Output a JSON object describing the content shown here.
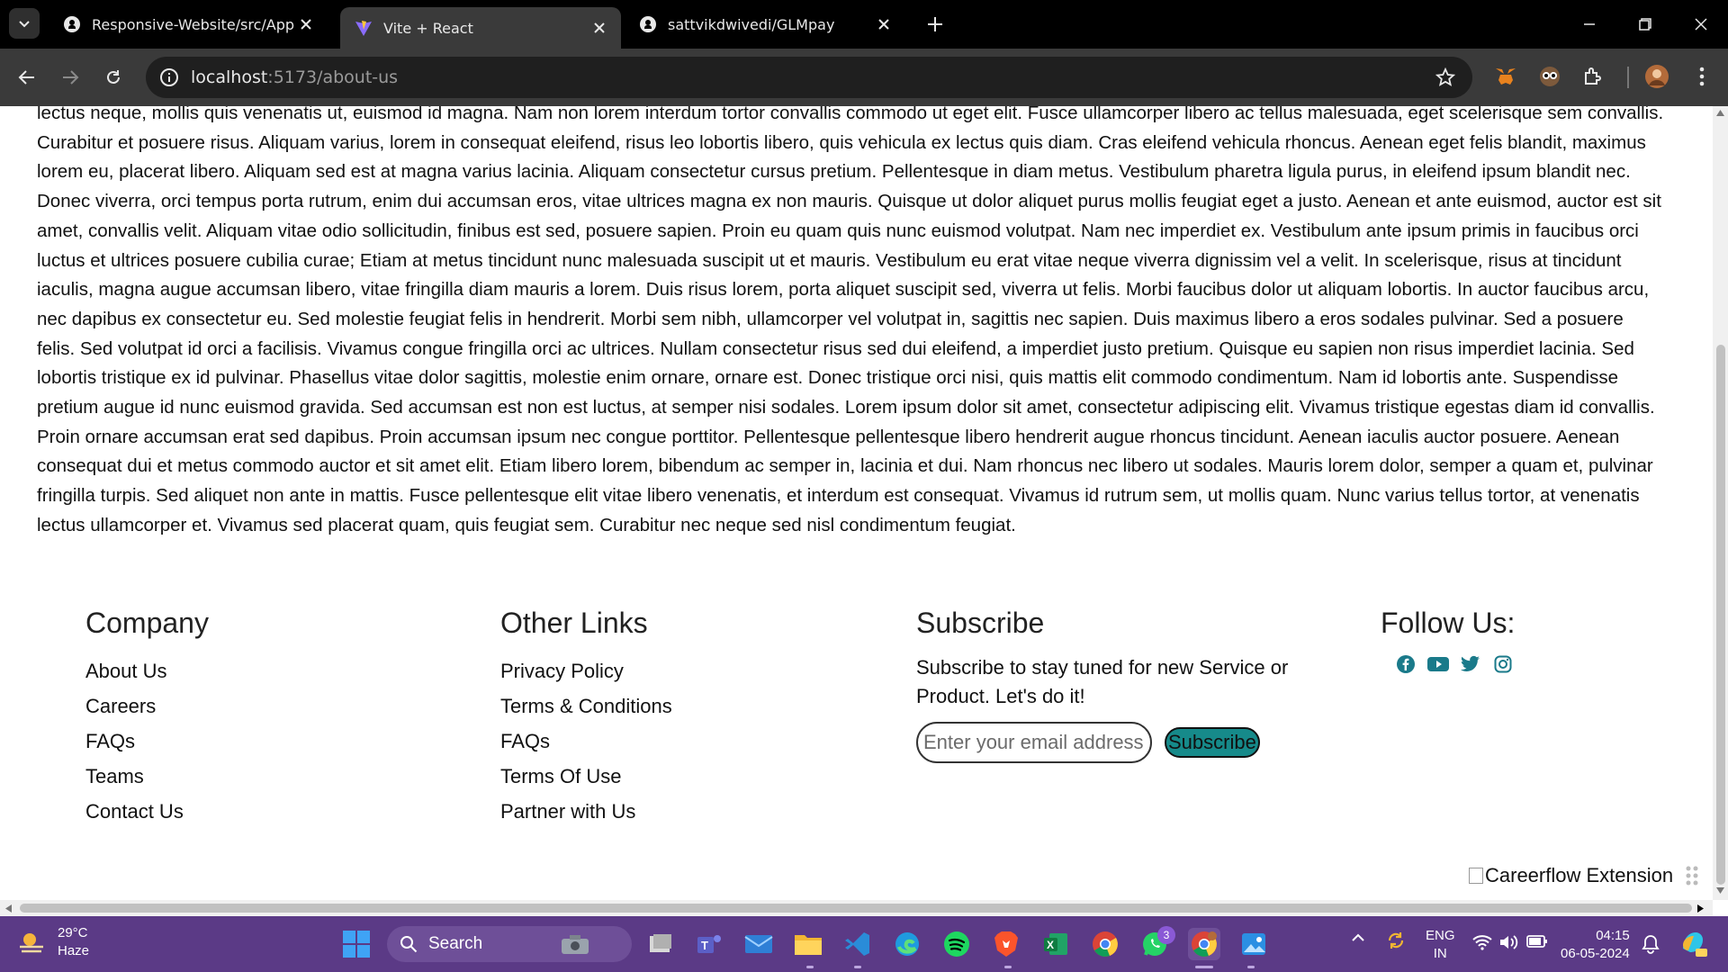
{
  "browser": {
    "tabs": [
      {
        "title": "Responsive-Website/src/App.jsx",
        "icon": "github-icon",
        "active": false
      },
      {
        "title": "Vite + React",
        "icon": "vite-icon",
        "active": true
      },
      {
        "title": "sattvikdwivedi/GLMpay",
        "icon": "github-icon",
        "active": false
      }
    ],
    "url_host": "localhost",
    "url_path": ":5173/about-us"
  },
  "article": {
    "text": "lectus neque, mollis quis venenatis ut, euismod id magna. Nam non lorem interdum tortor convallis commodo ut eget elit. Fusce ullamcorper libero ac tellus malesuada, eget scelerisque sem convallis. Curabitur et posuere risus. Aliquam varius, lorem in consequat eleifend, risus leo lobortis libero, quis vehicula ex lectus quis diam. Cras eleifend vehicula rhoncus. Aenean eget felis blandit, maximus lorem eu, placerat libero. Aliquam sed est at magna varius lacinia. Aliquam consectetur cursus pretium. Pellentesque in diam metus. Vestibulum pharetra ligula purus, in eleifend ipsum blandit nec. Donec viverra, orci tempus porta rutrum, enim dui accumsan eros, vitae ultrices magna ex non mauris. Quisque ut dolor aliquet purus mollis feugiat eget a justo. Aenean et ante euismod, auctor est sit amet, convallis velit. Aliquam vitae odio sollicitudin, finibus est sed, posuere sapien. Proin eu quam quis nunc euismod volutpat. Nam nec imperdiet ex. Vestibulum ante ipsum primis in faucibus orci luctus et ultrices posuere cubilia curae; Etiam at metus tincidunt nunc malesuada suscipit ut et mauris. Vestibulum eu erat vitae neque viverra dignissim vel a velit. In scelerisque, risus at tincidunt iaculis, magna augue accumsan libero, vitae fringilla diam mauris a lorem. Duis risus lorem, porta aliquet suscipit sed, viverra ut felis. Morbi faucibus dolor ut aliquam lobortis. In auctor faucibus arcu, nec dapibus ex consectetur eu. Sed molestie feugiat felis in hendrerit. Morbi sem nibh, ullamcorper vel volutpat in, sagittis nec sapien. Duis maximus libero a eros sodales pulvinar. Sed a posuere felis. Sed volutpat id orci a facilisis. Vivamus congue fringilla orci ac ultrices. Nullam consectetur risus sed dui eleifend, a imperdiet justo pretium. Quisque eu sapien non risus imperdiet lacinia. Sed lobortis tristique ex id pulvinar. Phasellus vitae dolor sagittis, molestie enim ornare, ornare est. Donec tristique orci nisi, quis mattis elit commodo condimentum. Nam id lobortis ante. Suspendisse pretium augue id nunc euismod gravida. Sed accumsan est non est luctus, at semper nisi sodales. Lorem ipsum dolor sit amet, consectetur adipiscing elit. Vivamus tristique egestas diam id convallis. Proin ornare accumsan erat sed dapibus. Proin accumsan ipsum nec congue porttitor. Pellentesque pellentesque libero hendrerit augue rhoncus tincidunt. Aenean iaculis auctor posuere. Aenean consequat dui et metus commodo auctor et sit amet elit. Etiam libero lorem, bibendum ac semper in, lacinia et dui. Nam rhoncus nec libero ut sodales. Mauris lorem dolor, semper a quam et, pulvinar fringilla turpis. Sed aliquet non ante in mattis. Fusce pellentesque elit vitae libero venenatis, et interdum est consequat. Vivamus id rutrum sem, ut mollis quam. Nunc varius tellus tortor, at venenatis lectus ullamcorper et. Vivamus sed placerat quam, quis feugiat sem. Curabitur nec neque sed nisl condimentum feugiat."
  },
  "footer": {
    "company": {
      "heading": "Company",
      "links": [
        "About Us",
        "Careers",
        "FAQs",
        "Teams",
        "Contact Us"
      ]
    },
    "other_links": {
      "heading": "Other Links",
      "links": [
        "Privacy Policy",
        "Terms & Conditions",
        "FAQs",
        "Terms Of Use",
        "Partner with Us"
      ]
    },
    "subscribe": {
      "heading": "Subscribe",
      "text": "Subscribe to stay tuned for new Service or Product. Let's do it!",
      "email_placeholder": "Enter your email address",
      "button_label": "Subscribe"
    },
    "follow": {
      "heading": "Follow Us:",
      "icons": [
        "facebook-icon",
        "youtube-icon",
        "twitter-icon",
        "instagram-icon"
      ],
      "icon_color": "#1a7a8a"
    }
  },
  "careerflow": {
    "alt_text": "Careerflow Extension"
  },
  "taskbar": {
    "weather_temp": "29°C",
    "weather_desc": "Haze",
    "search_label": "Search",
    "whatsapp_badge": "3",
    "lang_line1": "ENG",
    "lang_line2": "IN",
    "time": "04:15",
    "date": "06-05-2024",
    "accent": "#5b3a86"
  }
}
